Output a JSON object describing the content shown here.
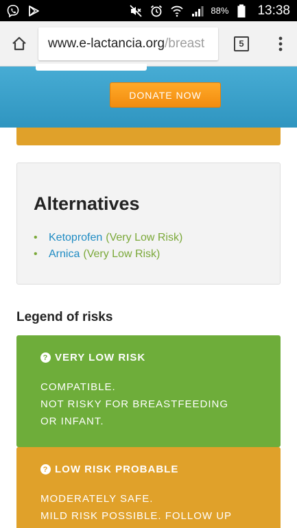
{
  "status_bar": {
    "icons_left": [
      "viber-icon",
      "play-store-icon"
    ],
    "icons_right": [
      "mute-icon",
      "alarm-icon",
      "wifi-icon",
      "signal-icon"
    ],
    "battery": "88%",
    "time": "13:38"
  },
  "browser": {
    "url_host": "www.e-lactancia.org",
    "url_path": "/breast",
    "tab_count": "5"
  },
  "donate": {
    "button_label": "DONATE NOW"
  },
  "alternatives": {
    "title": "Alternatives",
    "items": [
      {
        "name": "Ketoprofen",
        "risk": "(Very Low Risk)"
      },
      {
        "name": "Arnica",
        "risk": "(Very Low Risk)"
      }
    ]
  },
  "legend": {
    "title": "Legend of risks",
    "cards": [
      {
        "heading": "VERY LOW RISK",
        "lines": [
          "COMPATIBLE.",
          "NOT RISKY FOR BREASTFEEDING",
          "OR INFANT."
        ]
      },
      {
        "heading": "LOW RISK PROBABLE",
        "lines": [
          "MODERATELY SAFE.",
          "MILD RISK POSSIBLE. FOLLOW UP"
        ]
      }
    ]
  },
  "colors": {
    "blue_band": "#2f95c0",
    "donate_orange": "#f7951a",
    "link_blue": "#1e8bc3",
    "risk_green": "#6ead3a",
    "risk_orange": "#e0a12a"
  }
}
